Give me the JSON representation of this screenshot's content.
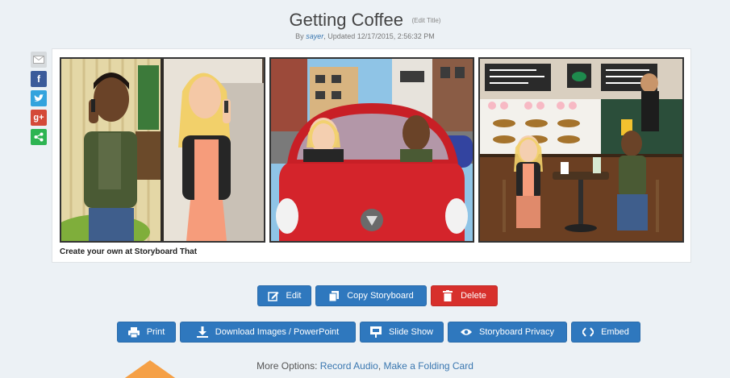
{
  "header": {
    "title": "Getting Coffee",
    "edit_title": "(Edit Title)",
    "byline_prefix": "By ",
    "author": "sayer",
    "byline_suffix": ", Updated 12/17/2015, 2:56:32 PM"
  },
  "share_icons": [
    "email-icon",
    "facebook-icon",
    "twitter-icon",
    "google-plus-icon",
    "share-icon"
  ],
  "share_labels": {
    "google_plus": "g+"
  },
  "storyboard": {
    "credit": "Create your own at Storyboard That"
  },
  "buttons": {
    "edit": "Edit",
    "copy": "Copy Storyboard",
    "delete": "Delete",
    "print": "Print",
    "download": "Download Images / PowerPoint",
    "slideshow": "Slide Show",
    "privacy": "Storyboard Privacy",
    "embed": "Embed"
  },
  "more_options": {
    "label": "More Options: ",
    "record_audio": "Record Audio",
    "separator": ", ",
    "folding_card": "Make a Folding Card"
  },
  "colors": {
    "primary_button": "#2f78be",
    "delete_button": "#d7302c",
    "arrow": "#f5a046",
    "background": "#ecf1f5"
  }
}
